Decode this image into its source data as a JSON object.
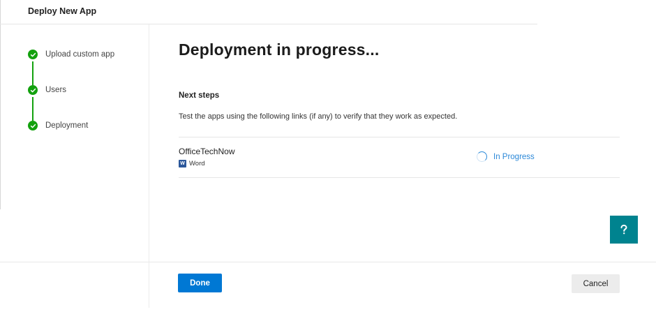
{
  "header": {
    "title": "Deploy New App"
  },
  "wizard": {
    "steps": [
      {
        "label": "Upload custom app",
        "icon": "checkmark-circle-icon",
        "status": "complete"
      },
      {
        "label": "Users",
        "icon": "checkmark-circle-icon",
        "status": "complete"
      },
      {
        "label": "Deployment",
        "icon": "checkmark-circle-icon",
        "status": "complete"
      }
    ],
    "complete_color": "#13a10e"
  },
  "main": {
    "title": "Deployment in progress...",
    "next_steps": {
      "heading": "Next steps",
      "description": "Test the apps using the following links (if any) to verify that they work as expected."
    },
    "apps": [
      {
        "name": "OfficeTechNow",
        "type_icon": "word-icon",
        "type_label": "Word",
        "status_icon": "spinner-icon",
        "status_label": "In Progress"
      }
    ]
  },
  "help_button": {
    "icon": "help-icon"
  },
  "footer": {
    "done_label": "Done",
    "cancel_label": "Cancel"
  },
  "colors": {
    "primary": "#0078d4",
    "link": "#2b88d8",
    "help": "#00838f",
    "word": "#2b579a"
  }
}
